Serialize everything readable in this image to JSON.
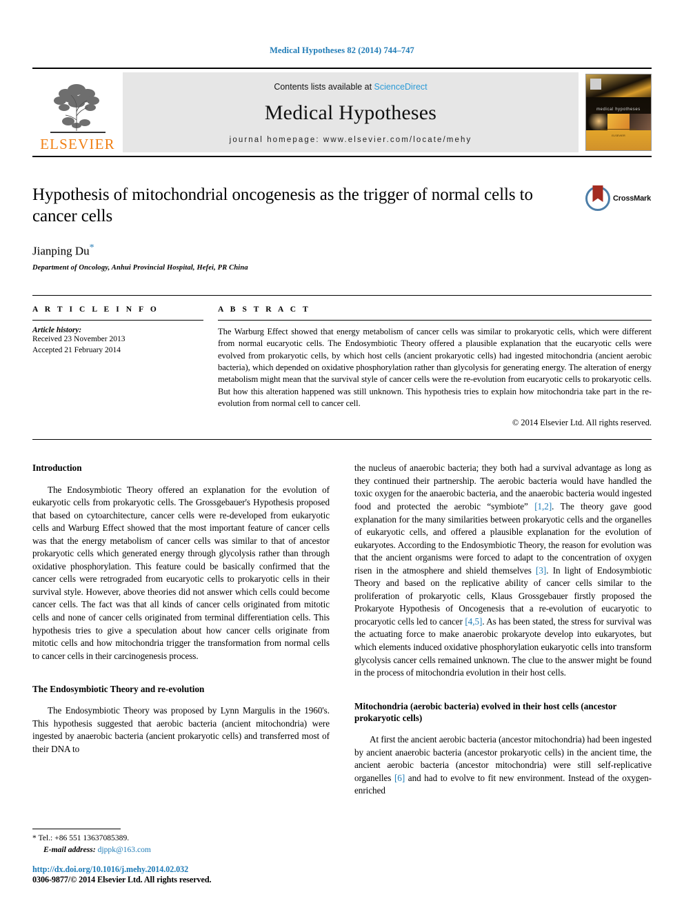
{
  "running_head": "Medical Hypotheses 82 (2014) 744–747",
  "masthead": {
    "publisher_word": "ELSEVIER",
    "contents_prefix": "Contents lists available at ",
    "sciencedirect": "ScienceDirect",
    "journal_title": "Medical Hypotheses",
    "homepage": "journal homepage: www.elsevier.com/locate/mehy",
    "cover_title": "medical hypotheses",
    "cover_publisher": "ELSEVIER"
  },
  "article": {
    "title": "Hypothesis of mitochondrial oncogenesis as the trigger of normal cells to cancer cells",
    "author": "Jianping Du",
    "author_marker": "*",
    "affiliation": "Department of Oncology, Anhui Provincial Hospital, Hefei, PR China",
    "crossmark_label": "CrossMark"
  },
  "info": {
    "heading": "A R T I C L E    I N F O",
    "history_label": "Article history:",
    "received": "Received 23 November 2013",
    "accepted": "Accepted 21 February 2014"
  },
  "abstract": {
    "heading": "A B S T R A C T",
    "text": "The Warburg Effect showed that energy metabolism of cancer cells was similar to prokaryotic cells, which were different from normal eucaryotic cells. The Endosymbiotic Theory offered a plausible explanation that the eucaryotic cells were evolved from prokaryotic cells, by which host cells (ancient prokaryotic cells) had ingested mitochondria (ancient aerobic bacteria), which depended on oxidative phosphorylation rather than glycolysis for generating energy. The alteration of energy metabolism might mean that the survival style of cancer cells were the re-evolution from eucaryotic cells to prokaryotic cells. But how this alteration happened was still unknown. This hypothesis tries to explain how mitochondria take part in the re-evolution from normal cell to cancer cell.",
    "copyright": "© 2014 Elsevier Ltd. All rights reserved."
  },
  "body": {
    "left": {
      "section1_heading": "Introduction",
      "section1_p1": "The Endosymbiotic Theory offered an explanation for the evolution of eukaryotic cells from prokaryotic cells. The Grossgebauer's Hypothesis proposed that based on cytoarchitecture, cancer cells were re-developed from eukaryotic cells and Warburg Effect showed that the most important feature of cancer cells was that the energy metabolism of cancer cells was similar to that of ancestor prokaryotic cells which generated energy through glycolysis rather than through oxidative phosphorylation. This feature could be basically confirmed that the cancer cells were retrograded from eucaryotic cells to prokaryotic cells in their survival style. However, above theories did not answer which cells could become cancer cells. The fact was that all kinds of cancer cells originated from mitotic cells and none of cancer cells originated from terminal differentiation cells. This hypothesis tries to give a speculation about how cancer cells originate from mitotic cells and how mitochondria trigger the transformation from normal cells to cancer cells in their carcinogenesis process.",
      "section2_heading": "The Endosymbiotic Theory and re-evolution",
      "section2_p1": "The Endosymbiotic Theory was proposed by Lynn Margulis in the 1960's. This hypothesis suggested that aerobic bacteria (ancient mitochondria) were ingested by anaerobic bacteria (ancient prokaryotic cells) and transferred most of their DNA to"
    },
    "right": {
      "cont_p1_a": "the nucleus of anaerobic bacteria; they both had a survival advantage as long as they continued their partnership. The aerobic bacteria would have handled the toxic oxygen for the anaerobic bacteria, and the anaerobic bacteria would ingested food and protected the aerobic “symbiote” ",
      "cont_p1_ref1": "[1,2]",
      "cont_p1_b": ". The theory gave good explanation for the many similarities between prokaryotic cells and the organelles of eukaryotic cells, and offered a plausible explanation for the evolution of eukaryotes. According to the Endosymbiotic Theory, the reason for evolution was that the ancient organisms were forced to adapt to the concentration of oxygen risen in the atmosphere and shield themselves ",
      "cont_p1_ref2": "[3]",
      "cont_p1_c": ". In light of Endosymbiotic Theory and based on the replicative ability of cancer cells similar to the proliferation of prokaryotic cells, Klaus Grossgebauer firstly proposed the Prokaryote Hypothesis of Oncogenesis that a re-evolution of eucaryotic to procaryotic cells led to cancer ",
      "cont_p1_ref3": "[4,5]",
      "cont_p1_d": ". As has been stated, the stress for survival was the actuating force to make anaerobic prokaryote develop into eukaryotes, but which elements induced oxidative phosphorylation eukaryotic cells into transform glycolysis cancer cells remained unknown. The clue to the answer might be found in the process of mitochondria evolution in their host cells.",
      "section3_heading": "Mitochondria (aerobic bacteria) evolved in their host cells (ancestor prokaryotic cells)",
      "section3_p1_a": "At first the ancient aerobic bacteria (ancestor mitochondria) had been ingested by ancient anaerobic bacteria (ancestor prokaryotic cells) in the ancient time, the ancient aerobic bacteria (ancestor mitochondria) were still self-replicative organelles ",
      "section3_p1_ref": "[6]",
      "section3_p1_b": " and had to evolve to fit new environment. Instead of the oxygen-enriched"
    }
  },
  "footnotes": {
    "tel_marker": "*",
    "tel": "Tel.: +86 551 13637085389.",
    "email_label": "E-mail address:",
    "email": "djppk@163.com",
    "doi": "http://dx.doi.org/10.1016/j.mehy.2014.02.032",
    "issn": "0306-9877/© 2014 Elsevier Ltd. All rights reserved."
  },
  "colors": {
    "link": "#1f7bb6",
    "sciencedirect": "#2a9ad6",
    "elsevier_orange": "#f07f13",
    "crossmark_red": "#a32b20",
    "crossmark_blue": "#4d7ea8"
  }
}
